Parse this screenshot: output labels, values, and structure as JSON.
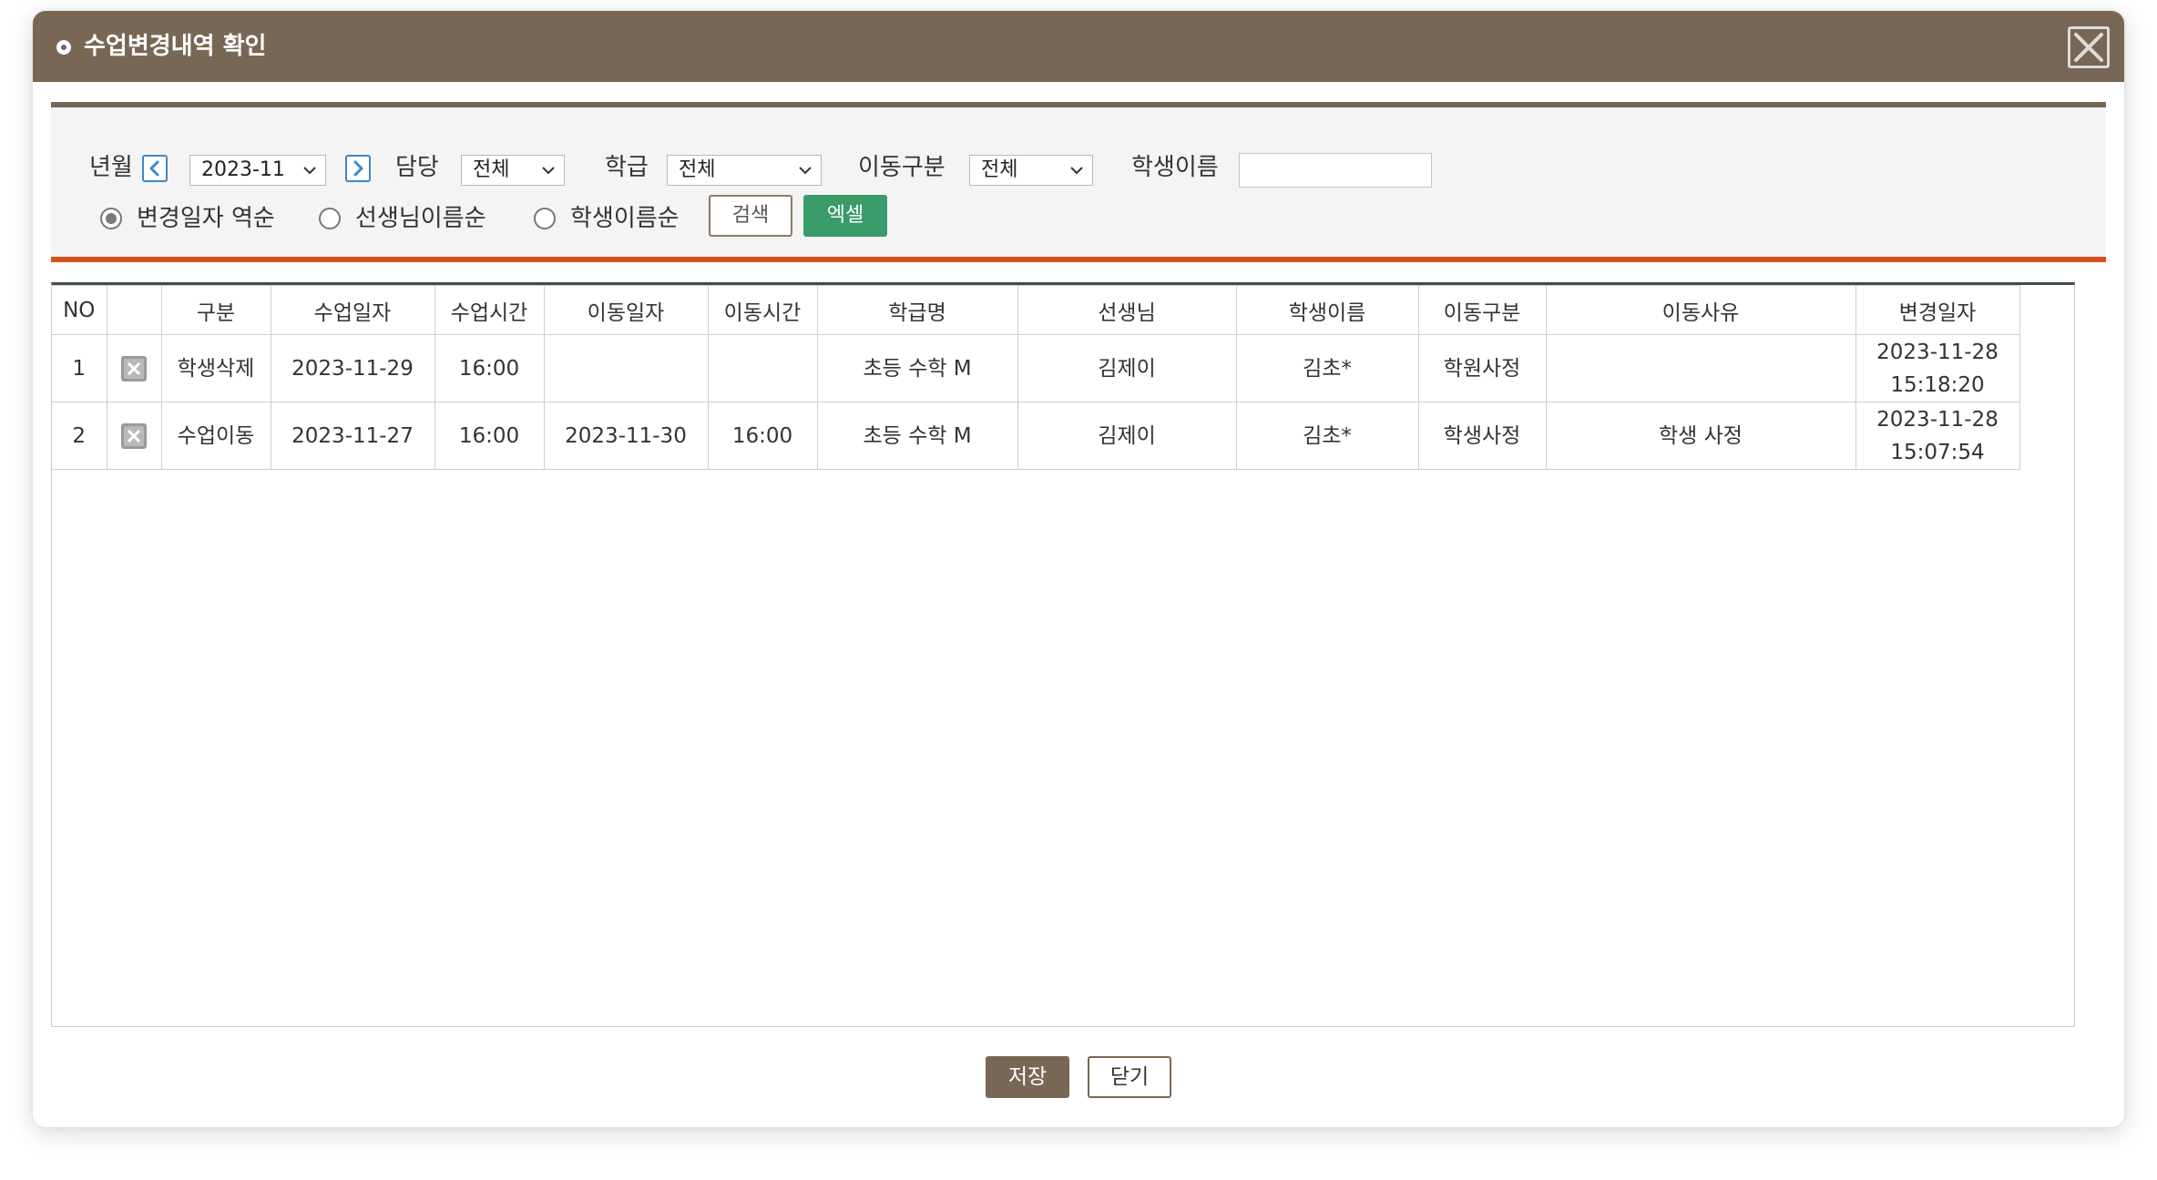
{
  "dialog": {
    "title": "수업변경내역 확인"
  },
  "filters": {
    "year_month_label": "년월",
    "year_month_value": "2023-11",
    "teacher_label": "담당",
    "teacher_value": "전체",
    "class_label": "학급",
    "class_value": "전체",
    "move_type_label": "이동구분",
    "move_type_value": "전체",
    "student_name_label": "학생이름",
    "student_name_value": "",
    "sort_options": [
      "변경일자 역순",
      "선생님이름순",
      "학생이름순"
    ],
    "sort_selected": "변경일자 역순",
    "search_label": "검색",
    "excel_label": "엑셀"
  },
  "table": {
    "columns": [
      "NO",
      "",
      "구분",
      "수업일자",
      "수업시간",
      "이동일자",
      "이동시간",
      "학급명",
      "선생님",
      "학생이름",
      "이동구분",
      "이동사유",
      "변경일자"
    ],
    "rows": [
      {
        "no": "1",
        "type": "학생삭제",
        "class_date": "2023-11-29",
        "class_time": "16:00",
        "move_date": "",
        "move_time": "",
        "class_name": "초등 수학 M",
        "teacher": "김제이",
        "student": "김초*",
        "move_type": "학원사정",
        "move_reason": "",
        "changed_date": "2023-11-28",
        "changed_time": "15:18:20"
      },
      {
        "no": "2",
        "type": "수업이동",
        "class_date": "2023-11-27",
        "class_time": "16:00",
        "move_date": "2023-11-30",
        "move_time": "16:00",
        "class_name": "초등 수학 M",
        "teacher": "김제이",
        "student": "김초*",
        "move_type": "학생사정",
        "move_reason": "학생 사정",
        "changed_date": "2023-11-28",
        "changed_time": "15:07:54"
      }
    ]
  },
  "footer": {
    "save_label": "저장",
    "close_label": "닫기"
  },
  "colors": {
    "titlebar": "#786754",
    "filter_top_rule": "#786754",
    "filter_bottom_rule": "#d8501f",
    "excel_button": "#3a9b6b",
    "arrow_button": "#3d87c9",
    "table_header_rule": "#3e4c52"
  },
  "icons": {
    "title": "circle-bullet-icon",
    "close": "close-x-icon",
    "prev": "chevron-left-icon",
    "next": "chevron-right-icon",
    "select": "chevron-down-icon",
    "row_action": "delete-row-icon"
  }
}
